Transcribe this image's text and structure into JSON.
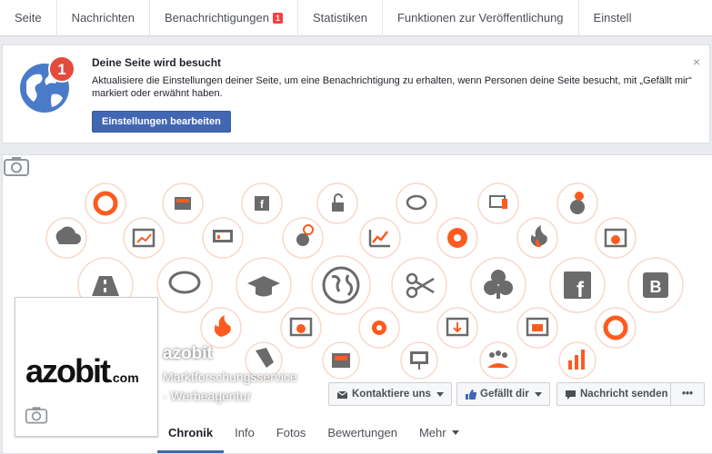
{
  "topnav": {
    "items": [
      "Seite",
      "Nachrichten",
      "Benachrichtigungen",
      "Statistiken",
      "Funktionen zur Veröffentlichung",
      "Einstell"
    ],
    "notifications_badge": "1"
  },
  "notice": {
    "badge": "1",
    "title": "Deine Seite wird besucht",
    "text": "Aktualisiere die Einstellungen deiner Seite, um eine Benachrichtigung zu erhalten, wenn Personen deine Seite besucht, mit „Gefällt mir“ markiert oder erwähnt haben.",
    "button": "Einstellungen bearbeiten",
    "close": "×"
  },
  "page": {
    "logo_text": "azobit",
    "logo_suffix": ".com",
    "name": "azobit",
    "category_line1": "Marktforschungsservice",
    "category_line2": "· Werbeagentur",
    "actions": {
      "contact": "Kontaktiere uns",
      "like": "Gefällt dir",
      "message": "Nachricht senden",
      "more": "•••"
    },
    "tabs": [
      "Chronik",
      "Info",
      "Fotos",
      "Bewertungen",
      "Mehr"
    ]
  },
  "colors": {
    "accent": "#4267b2",
    "badge": "#fa3e3e",
    "icon_orange": "#ff5a1f",
    "icon_gray": "#6b6b6b"
  }
}
